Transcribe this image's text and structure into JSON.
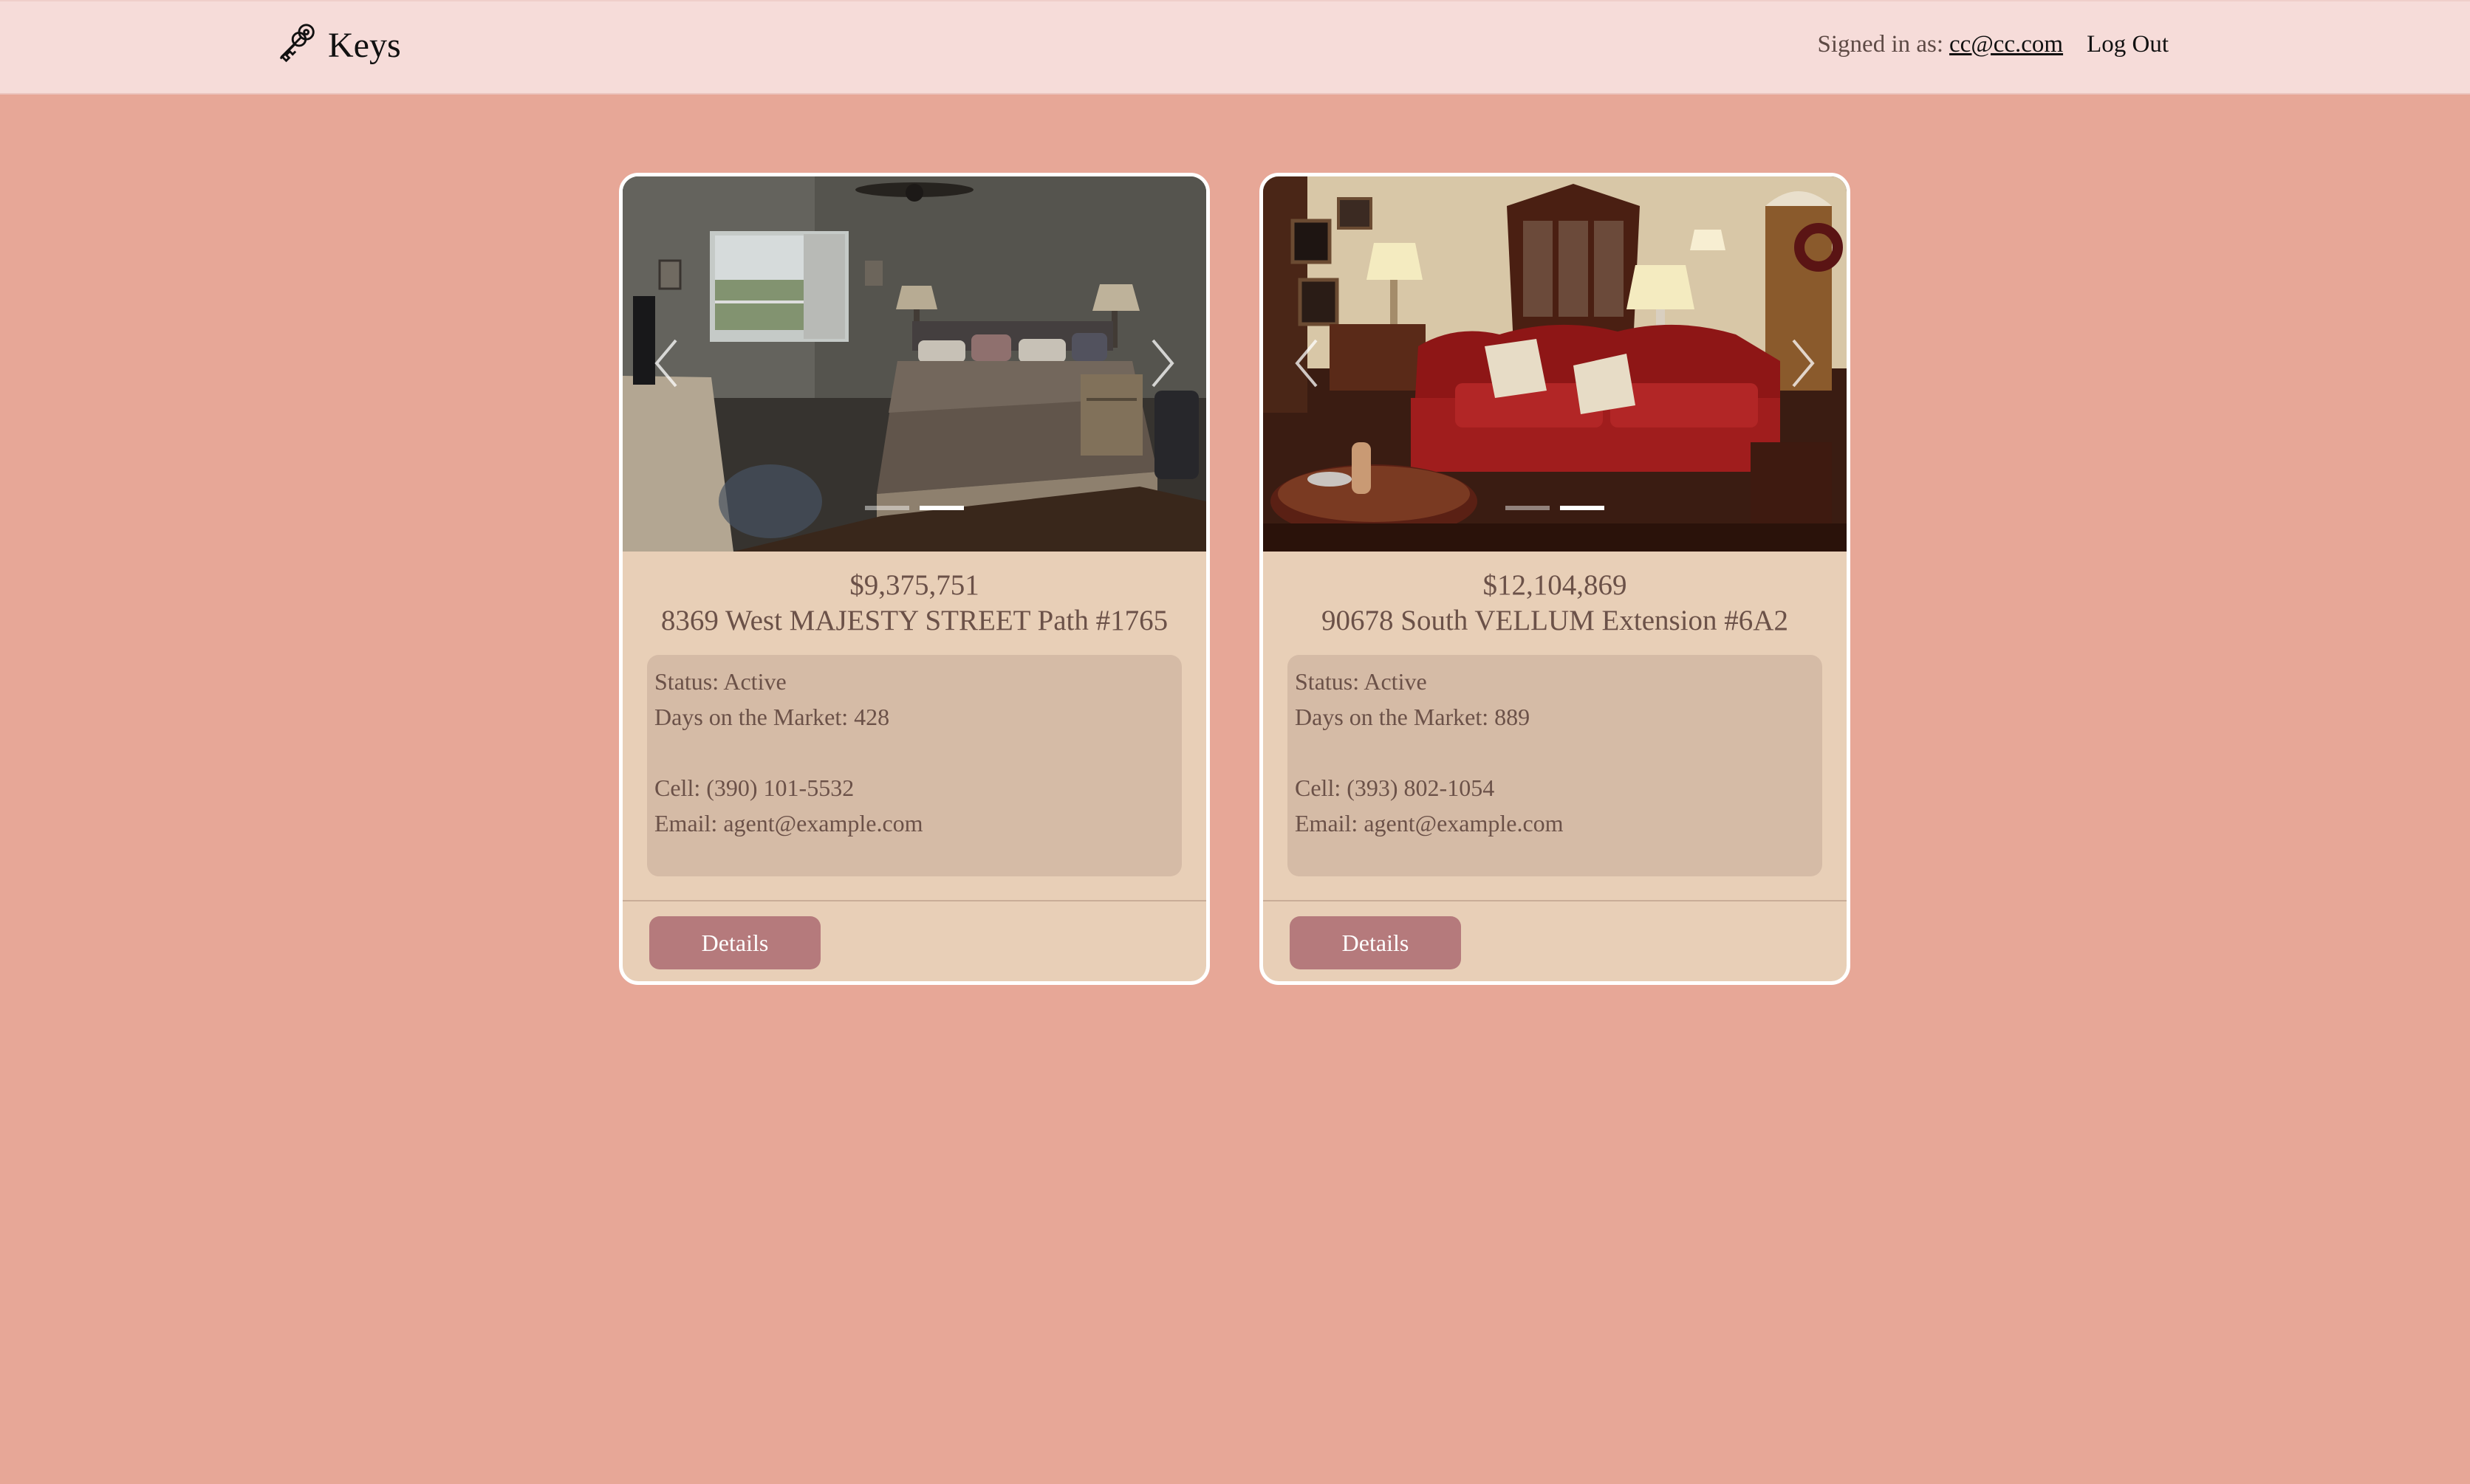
{
  "nav": {
    "brand": "Keys",
    "signed_in_label": "Signed in as:",
    "user_email": "cc@cc.com",
    "logout_label": "Log Out"
  },
  "listings": [
    {
      "photo": "bedroom-photo",
      "price": "$9,375,751",
      "address": "8369 West MAJESTY STREET Path #1765",
      "status": "Status: Active",
      "days_on_market": "Days on the Market: 428",
      "cell": "Cell: (390) 101-5532",
      "email": "Email: agent@example.com",
      "details_label": "Details",
      "active_slide": 2,
      "slide_count": 2
    },
    {
      "photo": "living-room-photo",
      "price": "$12,104,869",
      "address": "90678 South VELLUM Extension #6A2",
      "status": "Status: Active",
      "days_on_market": "Days on the Market: 889",
      "cell": "Cell: (393) 802-1054",
      "email": "Email: agent@example.com",
      "details_label": "Details",
      "active_slide": 2,
      "slide_count": 2
    }
  ],
  "colors": {
    "page_bg": "#e7a797",
    "nav_bg": "#f6dcd9",
    "card_bg": "#e8cfb7",
    "info_bg": "#d5bba6",
    "button_bg": "#b57a7c",
    "text": "#6b5148"
  }
}
